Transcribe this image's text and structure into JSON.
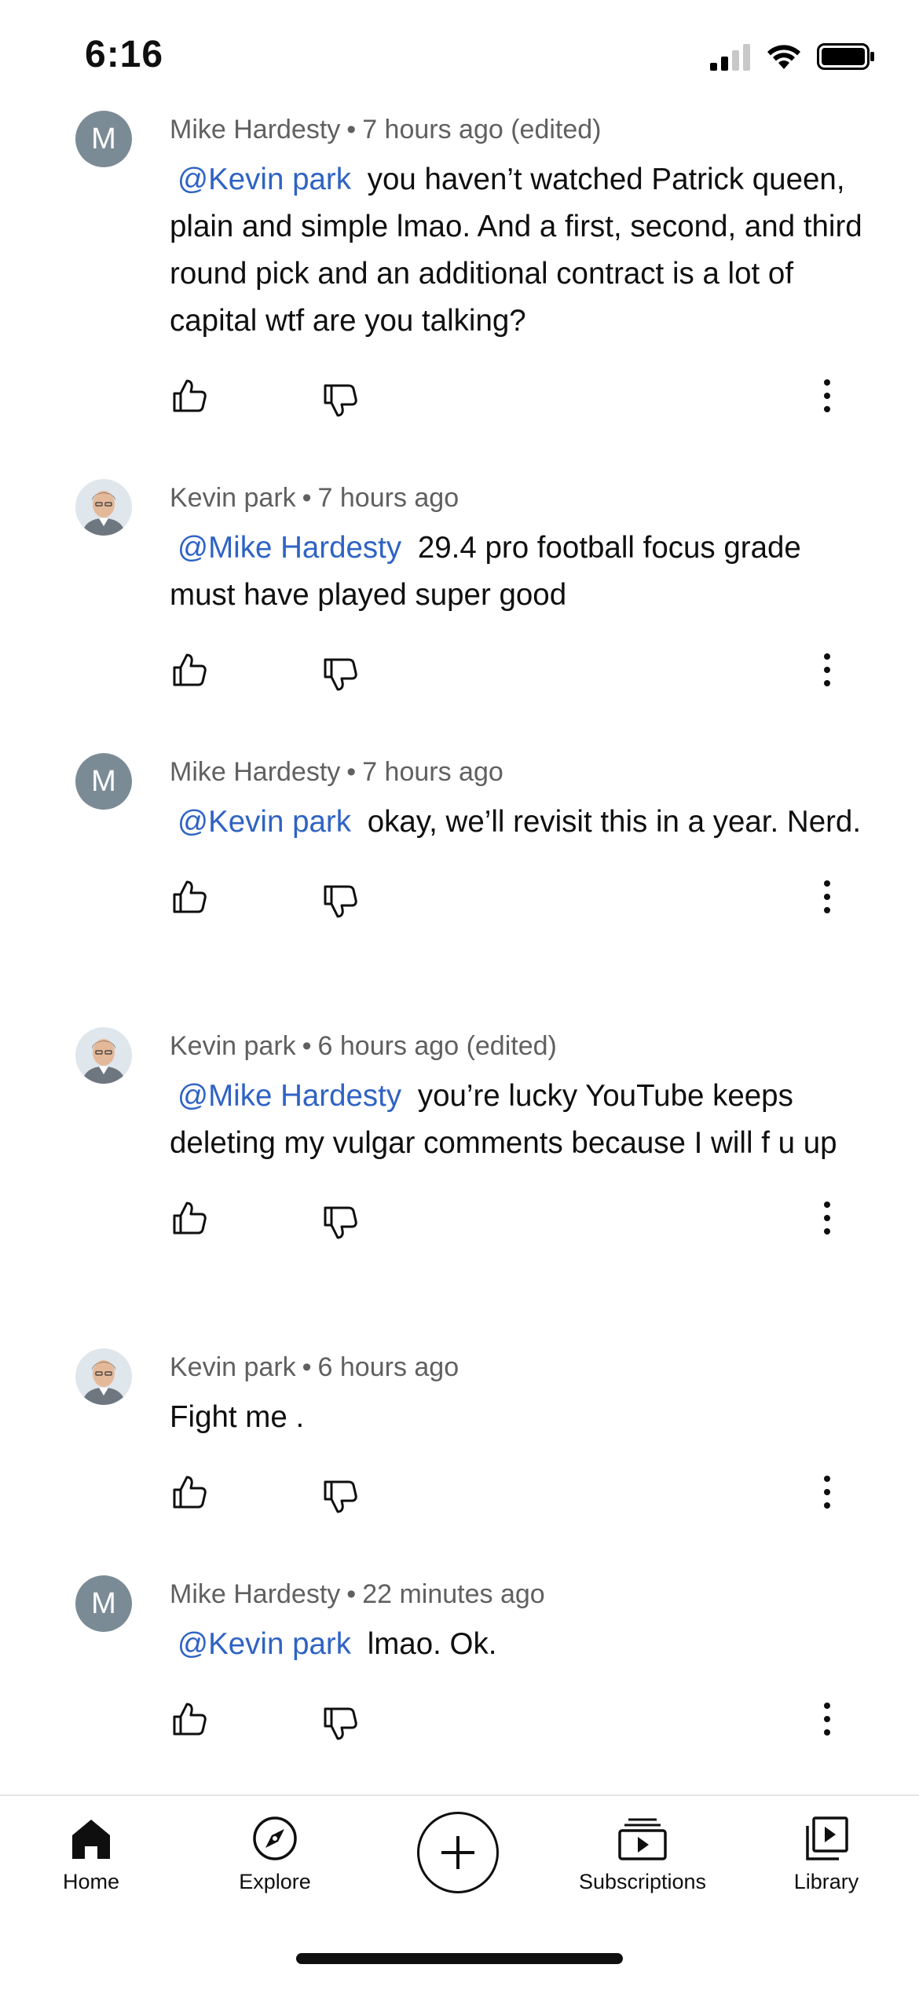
{
  "status_bar": {
    "time": "6:16"
  },
  "comments": [
    {
      "author": "Mike Hardesty",
      "avatar_letter": "M",
      "avatar_type": "letter",
      "time": "7 hours ago (edited)",
      "mention": "@Kevin park",
      "text": "you haven’t watched Patrick queen, plain and simple lmao. And a first, second, and third round pick and an additional contract is a lot of capital wtf are you talking?"
    },
    {
      "author": "Kevin park",
      "avatar_type": "photo",
      "time": "7 hours ago",
      "mention": "@Mike Hardesty",
      "text": "29.4 pro football focus grade must have played super good"
    },
    {
      "author": "Mike Hardesty",
      "avatar_letter": "M",
      "avatar_type": "letter",
      "time": "7 hours ago",
      "mention": "@Kevin park",
      "text": "okay, we’ll revisit this in a year. Nerd."
    },
    {
      "author": "Kevin park",
      "avatar_type": "photo",
      "time": "6 hours ago (edited)",
      "mention": "@Mike Hardesty",
      "text": "you’re lucky YouTube keeps deleting my vulgar comments because I will f u up"
    },
    {
      "author": "Kevin park",
      "avatar_type": "photo",
      "time": "6 hours ago",
      "mention": "",
      "text": "Fight me ."
    },
    {
      "author": "Mike Hardesty",
      "avatar_letter": "M",
      "avatar_type": "letter",
      "time": "22 minutes ago",
      "mention": "@Kevin park",
      "text": "lmao. Ok."
    }
  ],
  "separator": "•",
  "nav": {
    "home": "Home",
    "explore": "Explore",
    "subscriptions": "Subscriptions",
    "library": "Library"
  },
  "icons": {
    "like": "thumbs-up-icon",
    "dislike": "thumbs-down-icon",
    "more": "more-vertical-icon",
    "create": "plus-icon"
  },
  "colors": {
    "mention": "#2f63c4",
    "meta": "#606060",
    "avatar_letter_bg": "#7b8b96"
  }
}
